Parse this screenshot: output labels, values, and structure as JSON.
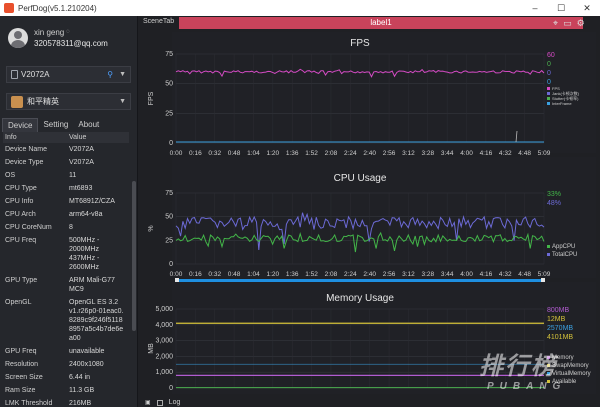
{
  "window": {
    "title": "PerfDog(v5.1.210204)"
  },
  "user": {
    "name": "xin geng",
    "email": "320578311@qq.com"
  },
  "device_select": {
    "value": "V2072A"
  },
  "app_select": {
    "value": "和平精英"
  },
  "tabs": [
    "Device",
    "Setting",
    "About"
  ],
  "info_table": {
    "headers": [
      "Info",
      "Value"
    ],
    "rows": [
      {
        "k": "Device Name",
        "v": "V2072A"
      },
      {
        "k": "Device Type",
        "v": "V2072A"
      },
      {
        "k": "OS",
        "v": "11"
      },
      {
        "k": "CPU Type",
        "v": "mt6893"
      },
      {
        "k": "CPU Info",
        "v": "MT6891Z/CZA"
      },
      {
        "k": "CPU Arch",
        "v": "arm64-v8a"
      },
      {
        "k": "CPU CoreNum",
        "v": "8"
      },
      {
        "k": "CPU Freq",
        "v": "500MHz -\n2000MHz\n437MHz -\n2600MHz"
      },
      {
        "k": "GPU Type",
        "v": "ARM Mali-G77\nMC9"
      },
      {
        "k": "OpenGL",
        "v": "OpenGL ES 3.2\nv1.r26p0-01eac0.\n8289c9f246f5118\n8957a5c4b7de6e\na00"
      },
      {
        "k": "GPU Freq",
        "v": "unavailable"
      },
      {
        "k": "Resolution",
        "v": "2400x1080"
      },
      {
        "k": "Screen Size",
        "v": "6.44 in"
      },
      {
        "k": "Ram Size",
        "v": "11.3 GB"
      },
      {
        "k": "LMK Threshold",
        "v": "216MB"
      }
    ]
  },
  "scene_tab": "SceneTab",
  "label_bar": "label1",
  "bottom": {
    "log_label": "Log"
  },
  "watermark": {
    "big": "排行榜",
    "small": "PUBANG"
  },
  "colors": {
    "accent": "#2f7fe8",
    "label": "#c9435b",
    "timeline": "#1e8fe0",
    "fps": "#d44bc4",
    "cpu_app": "#43b649",
    "cpu_total": "#6c6ad6",
    "mem_top": "#d4c23a",
    "mem_purple": "#b15cd0",
    "mem_green": "#4caf50"
  },
  "time_ticks": [
    "0:00",
    "0:16",
    "0:32",
    "0:48",
    "1:04",
    "1:20",
    "1:36",
    "1:52",
    "2:08",
    "2:24",
    "2:40",
    "2:56",
    "3:12",
    "3:28",
    "3:44",
    "4:00",
    "4:16",
    "4:32",
    "4:48",
    "5:09"
  ],
  "charts": [
    {
      "title": "FPS",
      "ylabel": "FPS",
      "yticks": [
        "75",
        "50",
        "25",
        "0"
      ],
      "values": [
        {
          "text": "60",
          "color": "#d44bc4"
        },
        {
          "text": "0",
          "color": "#4caf50"
        },
        {
          "text": "0",
          "color": "#6c6ad6"
        },
        {
          "text": "0",
          "color": "#3aa0e0"
        }
      ],
      "legend": [
        {
          "text": "FPS",
          "color": "#d44bc4"
        },
        {
          "text": "Jank(卡顿次数)",
          "color": "#6c6ad6"
        },
        {
          "text": "Stutter(卡顿率)",
          "color": "#4caf50"
        },
        {
          "text": "InterFrame",
          "color": "#3aa0e0"
        }
      ]
    },
    {
      "title": "CPU Usage",
      "ylabel": "%",
      "yticks": [
        "75",
        "50",
        "25",
        "0"
      ],
      "values": [
        {
          "text": "33%",
          "color": "#43b649"
        },
        {
          "text": "48%",
          "color": "#6c6ad6"
        }
      ],
      "legend": [
        {
          "text": "AppCPU",
          "color": "#43b649"
        },
        {
          "text": "TotalCPU",
          "color": "#6c6ad6"
        }
      ]
    },
    {
      "title": "Memory Usage",
      "ylabel": "MB",
      "yticks": [
        "5,000",
        "4,000",
        "3,000",
        "2,000",
        "1,000",
        "0"
      ],
      "values": [
        {
          "text": "800MB",
          "color": "#b15cd0"
        },
        {
          "text": "12MB",
          "color": "#d4c23a"
        },
        {
          "text": "2570MB",
          "color": "#3aa0e0"
        },
        {
          "text": "4101MB",
          "color": "#d4c23a"
        }
      ],
      "legend": [
        {
          "text": "Memory",
          "color": "#b15cd0"
        },
        {
          "text": "SwapMemory",
          "color": "#d4c23a"
        },
        {
          "text": "VirtualMemory",
          "color": "#3aa0e0"
        },
        {
          "text": "Available",
          "color": "#d4c23a"
        }
      ]
    }
  ]
}
